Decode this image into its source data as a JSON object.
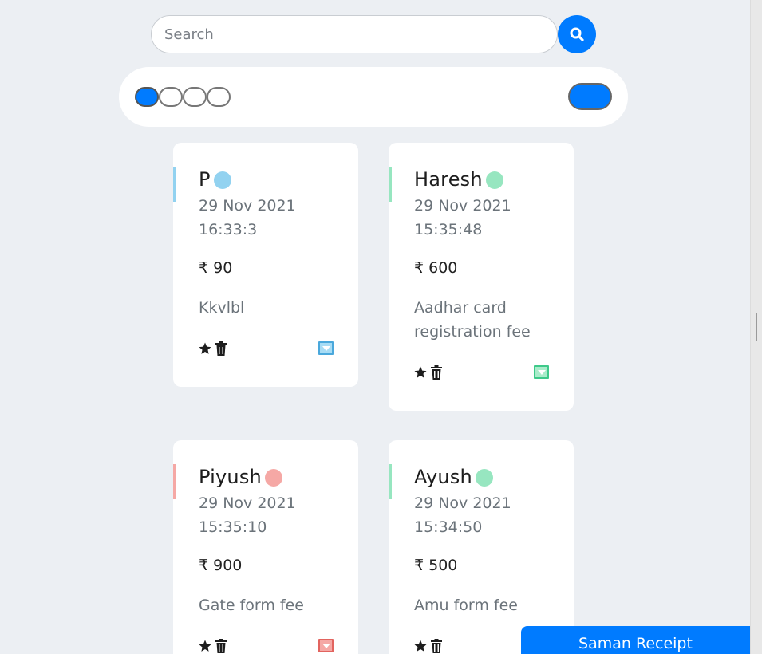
{
  "search": {
    "placeholder": "Search",
    "button_icon": "search-icon"
  },
  "filter_bar": {
    "dots": [
      {
        "label": "",
        "active": true
      },
      {
        "label": "",
        "active": false
      },
      {
        "label": "",
        "active": false
      },
      {
        "label": "",
        "active": false
      }
    ],
    "toggle_on": true
  },
  "colors": {
    "accent": "#007bff",
    "blue": "#92d2f0",
    "green": "#97e6c0",
    "red": "#f5a8a5"
  },
  "cards": [
    {
      "name": "P",
      "status_color": "blue",
      "date": "29 Nov 2021",
      "time": "16:33:3",
      "amount": "₹ 90",
      "description": "Kkvlbl"
    },
    {
      "name": "Haresh",
      "status_color": "green",
      "date": "29 Nov 2021",
      "time": "15:35:48",
      "amount": "₹ 600",
      "description": "Aadhar card registration fee"
    },
    {
      "name": "Piyush",
      "status_color": "red",
      "date": "29 Nov 2021",
      "time": "15:35:10",
      "amount": "₹ 900",
      "description": "Gate form fee"
    },
    {
      "name": "Ayush",
      "status_color": "green",
      "date": "29 Nov 2021",
      "time": "15:34:50",
      "amount": "₹ 500",
      "description": "Amu form fee"
    }
  ],
  "footer": {
    "saman_receipt_label": "Saman Receipt"
  }
}
